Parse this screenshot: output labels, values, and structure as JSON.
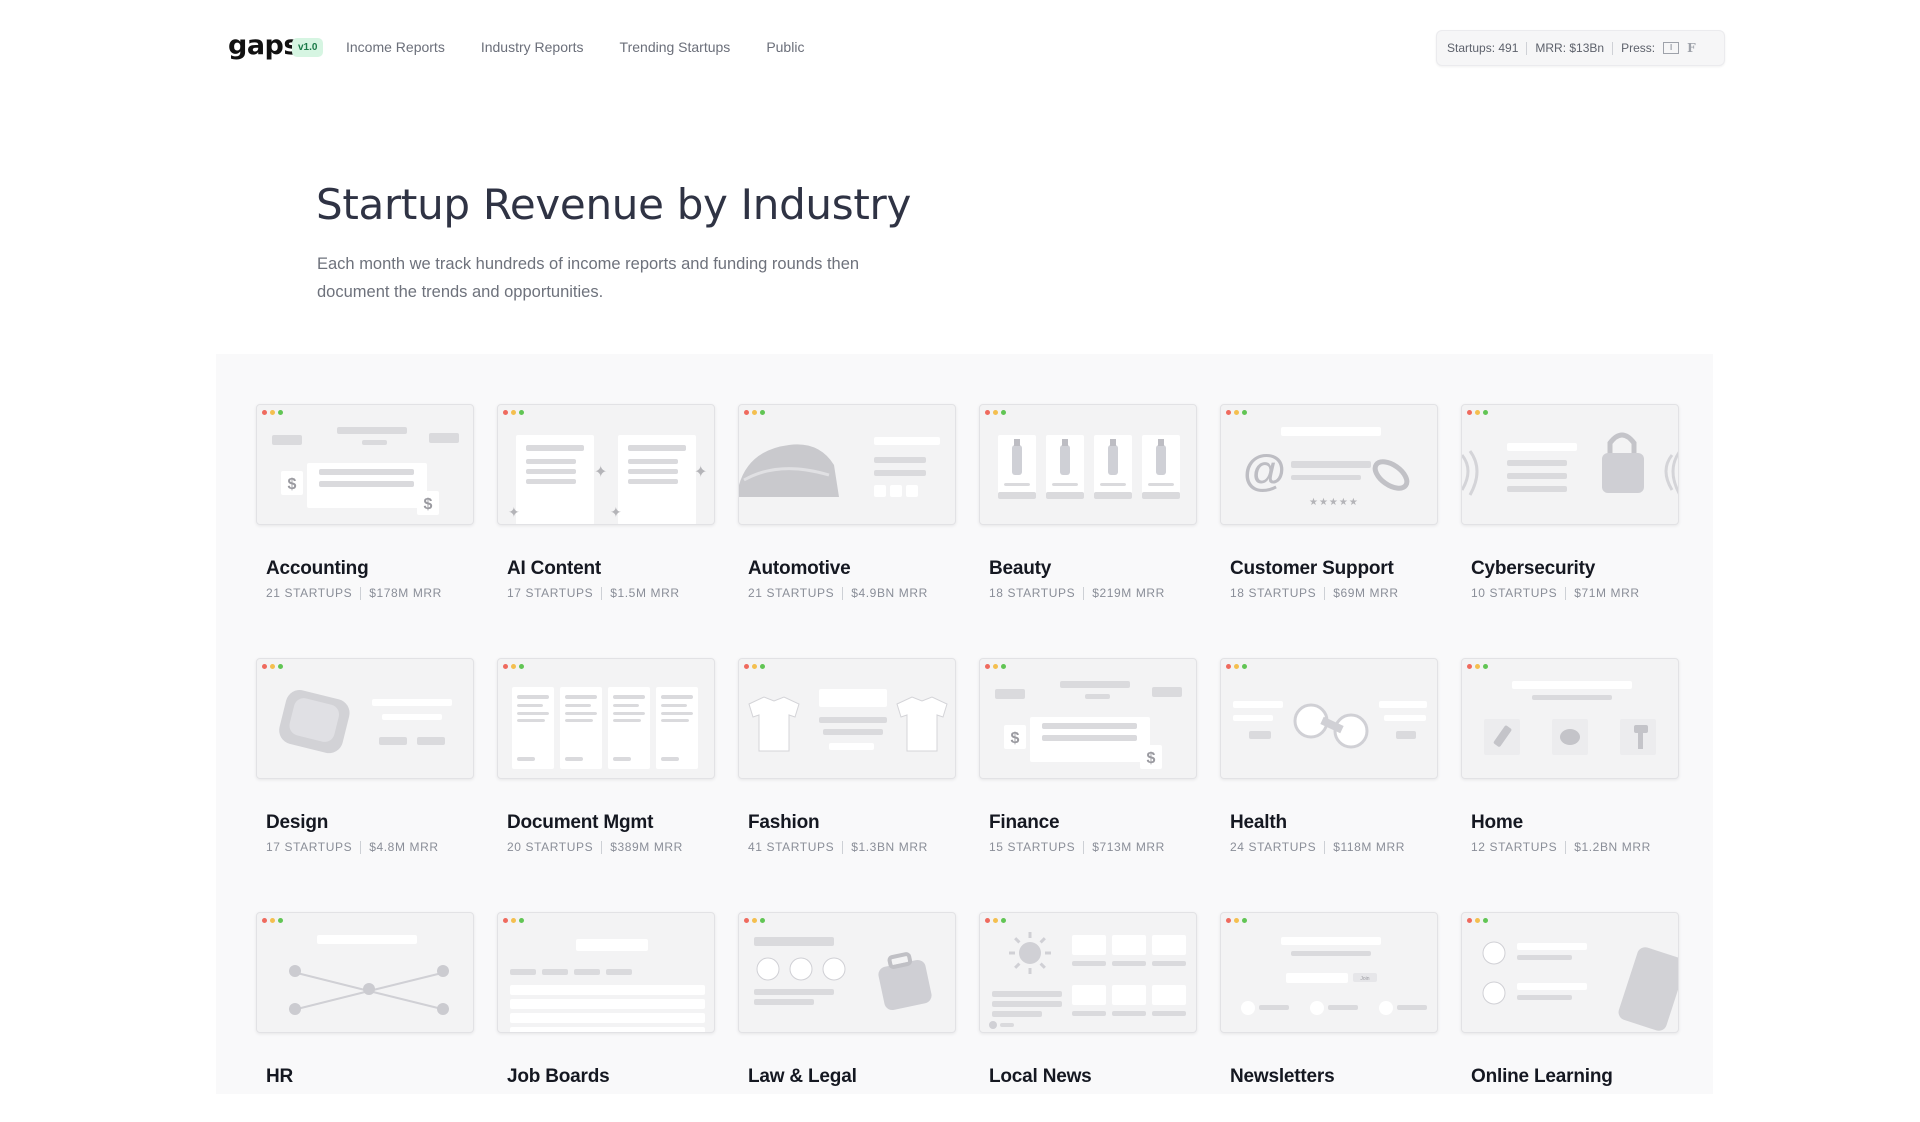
{
  "header": {
    "logo": "gaps",
    "version": "v1.0",
    "nav": [
      "Income Reports",
      "Industry Reports",
      "Trending Startups",
      "Public"
    ],
    "stats": {
      "startups": "Startups: 491",
      "mrr": "MRR: $13Bn",
      "press_label": "Press:"
    }
  },
  "hero": {
    "title": "Startup Revenue by Industry",
    "subtitle": "Each month we track hundreds of income reports and funding rounds then document the trends and opportunities."
  },
  "colors": {
    "dot_red": "#ef6a5e",
    "dot_yellow": "#f4bf4f",
    "dot_green": "#61c554",
    "version_bg": "#d6f5e2"
  },
  "industries": [
    {
      "name": "Accounting",
      "startups": "21 STARTUPS",
      "mrr": "$178M MRR",
      "illustration": "dollar-icons"
    },
    {
      "name": "AI Content",
      "startups": "17 STARTUPS",
      "mrr": "$1.5M MRR",
      "illustration": "sparkle-icons"
    },
    {
      "name": "Automotive",
      "startups": "21 STARTUPS",
      "mrr": "$4.9BN MRR",
      "illustration": "car-icon"
    },
    {
      "name": "Beauty",
      "startups": "18 STARTUPS",
      "mrr": "$219M MRR",
      "illustration": "bottle-icons"
    },
    {
      "name": "Customer Support",
      "startups": "18 STARTUPS",
      "mrr": "$69M MRR",
      "illustration": "at-sign-icon"
    },
    {
      "name": "Cybersecurity",
      "startups": "10 STARTUPS",
      "mrr": "$71M MRR",
      "illustration": "padlock-icon"
    },
    {
      "name": "Design",
      "startups": "17 STARTUPS",
      "mrr": "$4.8M MRR",
      "illustration": "ruler-icon"
    },
    {
      "name": "Document Mgmt",
      "startups": "20 STARTUPS",
      "mrr": "$389M MRR",
      "illustration": "document-icons"
    },
    {
      "name": "Fashion",
      "startups": "41 STARTUPS",
      "mrr": "$1.3BN MRR",
      "illustration": "shirt-icons"
    },
    {
      "name": "Finance",
      "startups": "15 STARTUPS",
      "mrr": "$713M MRR",
      "illustration": "dollar-icons"
    },
    {
      "name": "Health",
      "startups": "24 STARTUPS",
      "mrr": "$118M MRR",
      "illustration": "dumbbell-icon"
    },
    {
      "name": "Home",
      "startups": "12 STARTUPS",
      "mrr": "$1.2BN MRR",
      "illustration": "tools-icons"
    },
    {
      "name": "HR",
      "startups": "",
      "mrr": "",
      "illustration": "network-icon"
    },
    {
      "name": "Job Boards",
      "startups": "",
      "mrr": "",
      "illustration": "search-list-icon"
    },
    {
      "name": "Law & Legal",
      "startups": "",
      "mrr": "",
      "illustration": "briefcase-icon"
    },
    {
      "name": "Local News",
      "startups": "",
      "mrr": "",
      "illustration": "sun-icon"
    },
    {
      "name": "Newsletters",
      "startups": "",
      "mrr": "",
      "illustration": "newsletter-icon"
    },
    {
      "name": "Online Learning",
      "startups": "",
      "mrr": "",
      "illustration": "book-icon"
    }
  ]
}
